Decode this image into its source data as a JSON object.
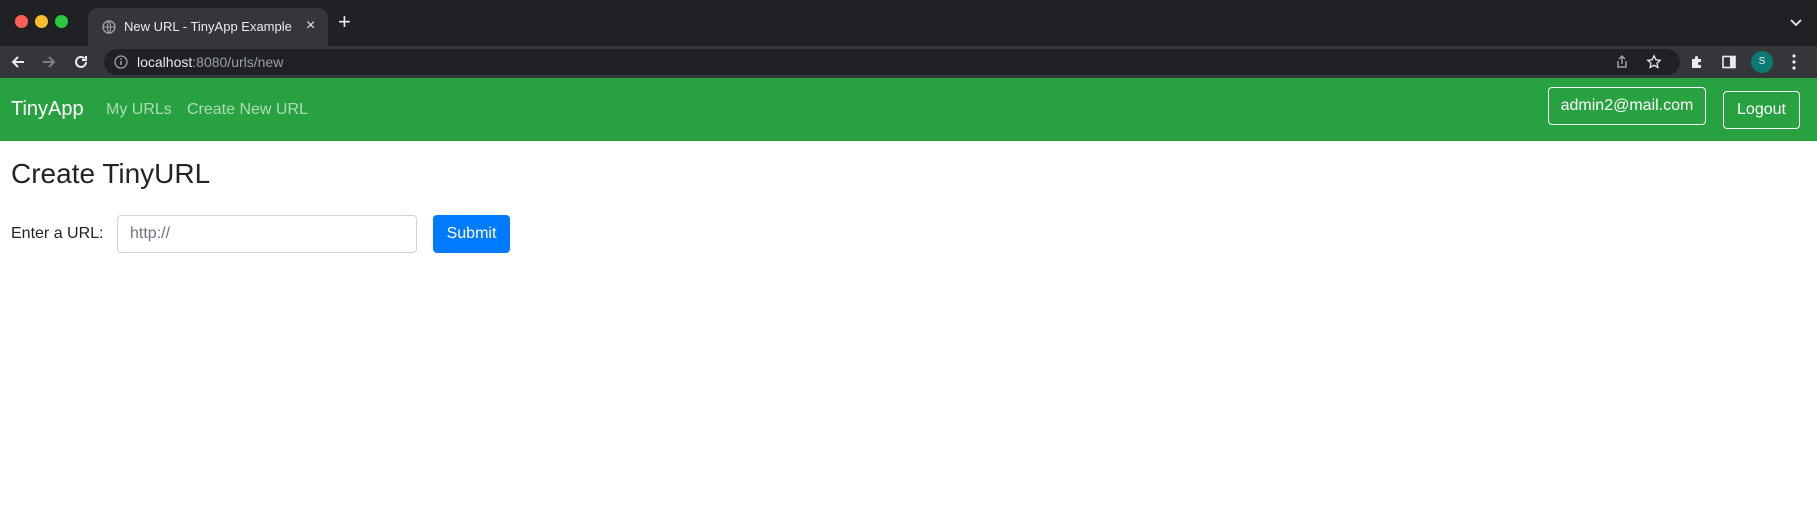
{
  "browser": {
    "tab_title": "New URL - TinyApp Example",
    "tab_close": "×",
    "new_tab": "+",
    "url_host": "localhost",
    "url_path": ":8080/urls/new",
    "profile_initial": "S"
  },
  "navbar": {
    "brand": "TinyApp",
    "links": [
      "My URLs",
      "Create New URL"
    ],
    "user_email": "admin2@mail.com",
    "logout_label": "Logout",
    "color": "#28a140"
  },
  "main": {
    "title": "Create TinyURL",
    "url_label": "Enter a URL:",
    "url_placeholder": "http://",
    "submit_label": "Submit",
    "submit_color": "#007bff"
  }
}
